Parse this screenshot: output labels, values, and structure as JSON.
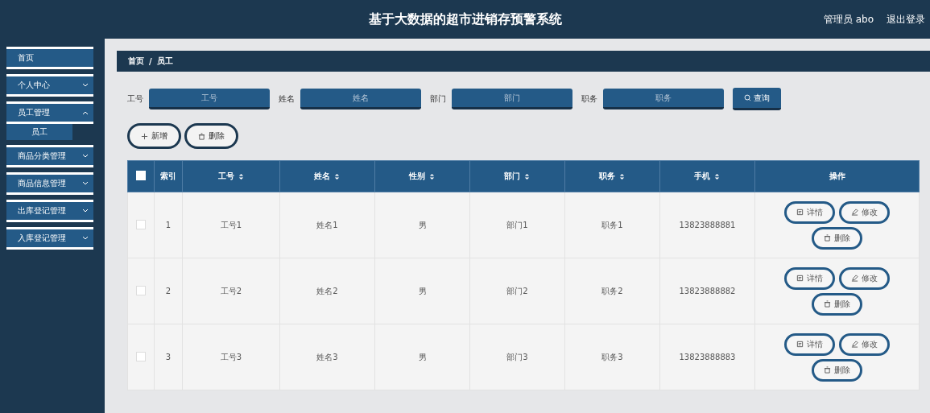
{
  "header": {
    "title": "基于大数据的超市进销存预警系统",
    "user": "管理员 abo",
    "logout": "退出登录"
  },
  "sidebar": {
    "items": [
      {
        "label": "首页"
      },
      {
        "label": "个人中心",
        "expanded": false
      },
      {
        "label": "员工管理",
        "expanded": true,
        "children": [
          {
            "label": "员工",
            "selected": true
          }
        ]
      },
      {
        "label": "商品分类管理",
        "expanded": false
      },
      {
        "label": "商品信息管理",
        "expanded": false
      },
      {
        "label": "出库登记管理",
        "expanded": false
      },
      {
        "label": "入库登记管理",
        "expanded": false
      }
    ]
  },
  "breadcrumb": {
    "items": [
      "首页",
      "员工"
    ],
    "separator": "/"
  },
  "filters": [
    {
      "label": "工号",
      "placeholder": "工号"
    },
    {
      "label": "姓名",
      "placeholder": "姓名"
    },
    {
      "label": "部门",
      "placeholder": "部门"
    },
    {
      "label": "职务",
      "placeholder": "职务"
    }
  ],
  "search_button": "查询",
  "actions": [
    {
      "kind": "add",
      "label": "新增"
    },
    {
      "kind": "delete",
      "label": "删除"
    }
  ],
  "table": {
    "select_all": {
      "checked": false
    },
    "columns": [
      {
        "label": "索引",
        "sortable": false
      },
      {
        "label": "工号",
        "sortable": true
      },
      {
        "label": "姓名",
        "sortable": true
      },
      {
        "label": "性别",
        "sortable": true
      },
      {
        "label": "部门",
        "sortable": true
      },
      {
        "label": "职务",
        "sortable": true
      },
      {
        "label": "手机",
        "sortable": true
      },
      {
        "label": "操作",
        "sortable": false
      }
    ],
    "rows": [
      {
        "checked": false,
        "cells": [
          "1",
          "工号1",
          "姓名1",
          "男",
          "部门1",
          "职务1",
          "13823888881"
        ],
        "buttons": [
          {
            "kind": "detail",
            "label": "详情"
          },
          {
            "kind": "edit",
            "label": "修改"
          },
          {
            "kind": "delete",
            "label": "删除"
          }
        ]
      },
      {
        "checked": false,
        "cells": [
          "2",
          "工号2",
          "姓名2",
          "男",
          "部门2",
          "职务2",
          "13823888882"
        ],
        "buttons": [
          {
            "kind": "detail",
            "label": "详情"
          },
          {
            "kind": "edit",
            "label": "修改"
          },
          {
            "kind": "delete",
            "label": "删除"
          }
        ]
      },
      {
        "checked": false,
        "cells": [
          "3",
          "工号3",
          "姓名3",
          "男",
          "部门3",
          "职务3",
          "13823888883"
        ],
        "buttons": [
          {
            "kind": "detail",
            "label": "详情"
          },
          {
            "kind": "edit",
            "label": "修改"
          },
          {
            "kind": "delete",
            "label": "删除"
          }
        ]
      }
    ]
  }
}
